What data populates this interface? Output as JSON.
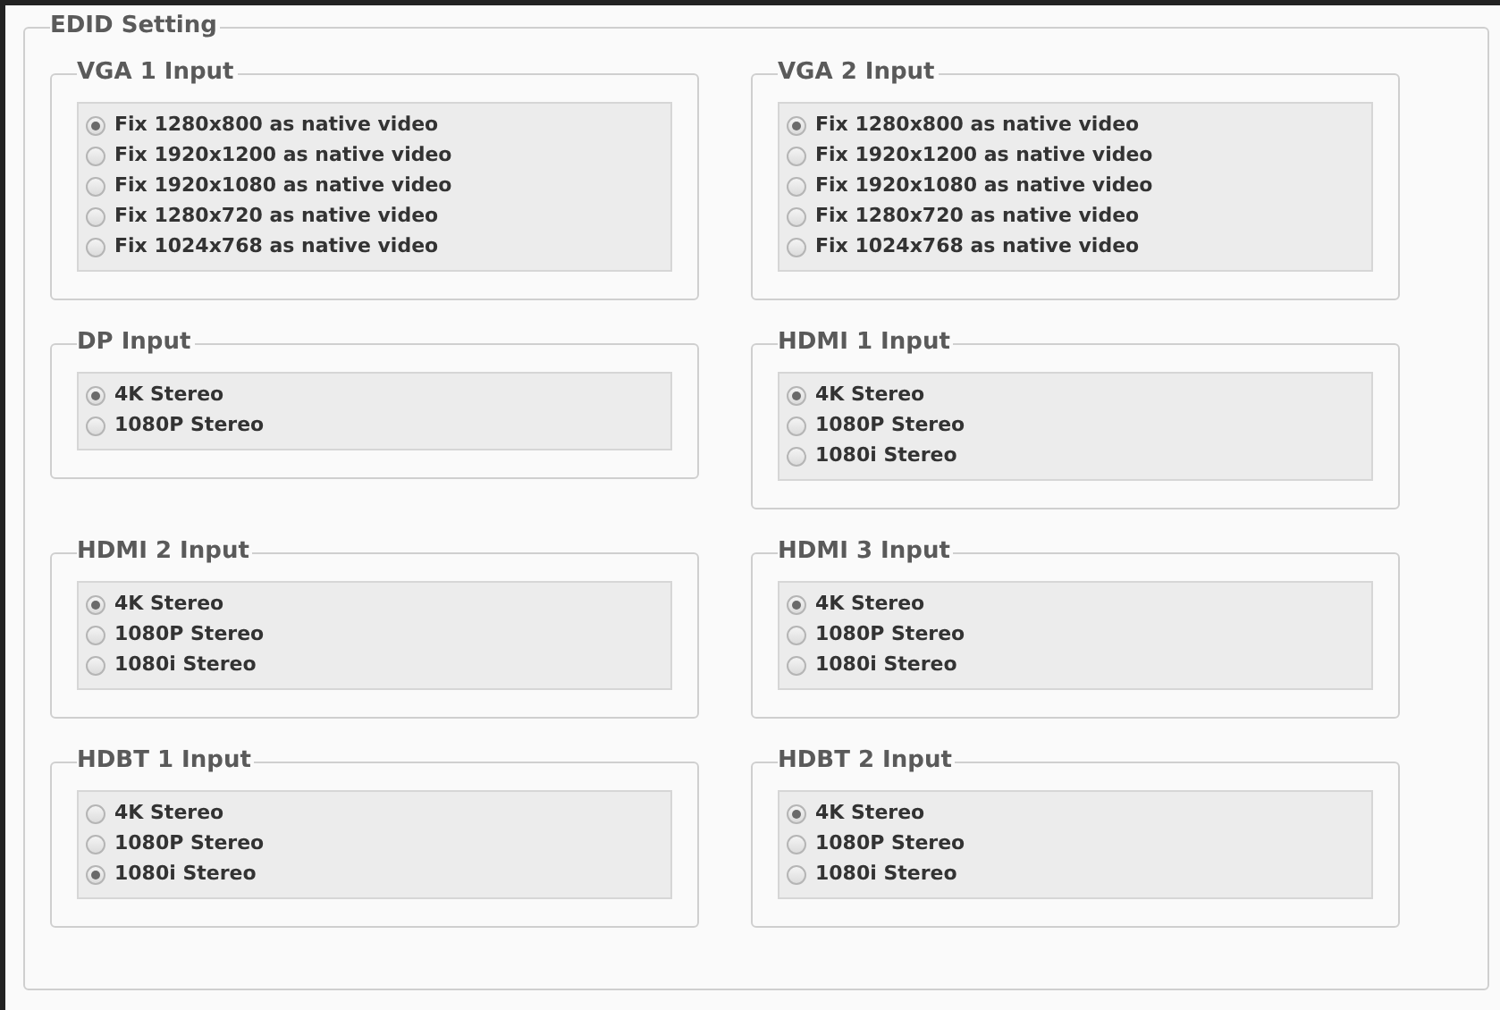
{
  "panel": {
    "title": "EDID Setting"
  },
  "inputs": [
    {
      "title": "VGA 1 Input",
      "options": [
        {
          "label": "Fix 1280x800 as native video",
          "selected": true
        },
        {
          "label": "Fix 1920x1200 as native video",
          "selected": false
        },
        {
          "label": "Fix 1920x1080 as native video",
          "selected": false
        },
        {
          "label": "Fix 1280x720 as native video",
          "selected": false
        },
        {
          "label": "Fix 1024x768 as native video",
          "selected": false
        }
      ]
    },
    {
      "title": "VGA 2 Input",
      "options": [
        {
          "label": "Fix 1280x800 as native video",
          "selected": true
        },
        {
          "label": "Fix 1920x1200 as native video",
          "selected": false
        },
        {
          "label": "Fix 1920x1080 as native video",
          "selected": false
        },
        {
          "label": "Fix 1280x720 as native video",
          "selected": false
        },
        {
          "label": "Fix 1024x768 as native video",
          "selected": false
        }
      ]
    },
    {
      "title": "DP Input",
      "options": [
        {
          "label": "4K Stereo",
          "selected": true
        },
        {
          "label": "1080P Stereo",
          "selected": false
        }
      ]
    },
    {
      "title": "HDMI 1 Input",
      "options": [
        {
          "label": "4K Stereo",
          "selected": true
        },
        {
          "label": "1080P Stereo",
          "selected": false
        },
        {
          "label": "1080i Stereo",
          "selected": false
        }
      ]
    },
    {
      "title": "HDMI 2 Input",
      "options": [
        {
          "label": "4K Stereo",
          "selected": true
        },
        {
          "label": "1080P Stereo",
          "selected": false
        },
        {
          "label": "1080i Stereo",
          "selected": false
        }
      ]
    },
    {
      "title": "HDMI 3 Input",
      "options": [
        {
          "label": "4K Stereo",
          "selected": true
        },
        {
          "label": "1080P Stereo",
          "selected": false
        },
        {
          "label": "1080i Stereo",
          "selected": false
        }
      ]
    },
    {
      "title": "HDBT 1 Input",
      "options": [
        {
          "label": "4K Stereo",
          "selected": false
        },
        {
          "label": "1080P Stereo",
          "selected": false
        },
        {
          "label": "1080i Stereo",
          "selected": true
        }
      ]
    },
    {
      "title": "HDBT 2 Input",
      "options": [
        {
          "label": "4K Stereo",
          "selected": true
        },
        {
          "label": "1080P Stereo",
          "selected": false
        },
        {
          "label": "1080i Stereo",
          "selected": false
        }
      ]
    }
  ]
}
